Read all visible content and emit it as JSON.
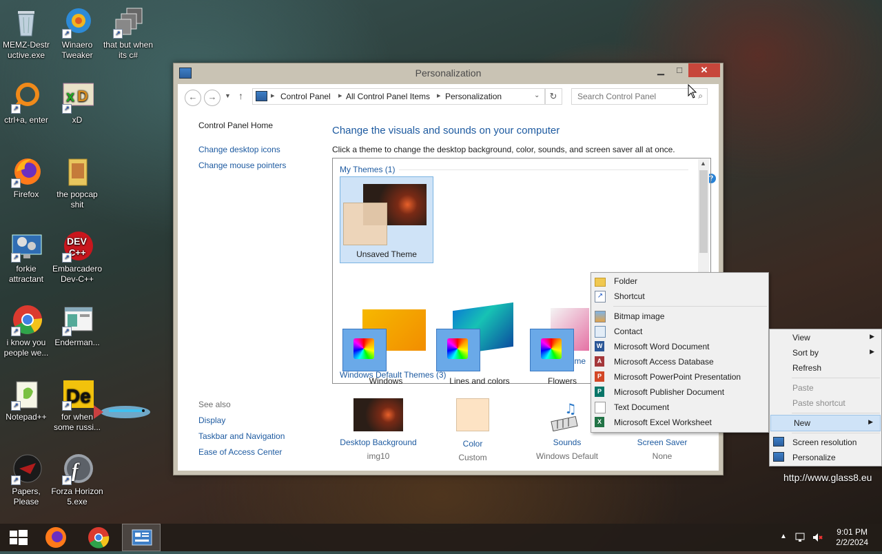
{
  "desktop": {
    "icons": [
      {
        "label": "MEMZ-Destr uctive.exe",
        "icon": "recycle-bin-icon"
      },
      {
        "label": "Winaero Tweaker",
        "icon": "winaero-icon"
      },
      {
        "label": "that but when its c#",
        "icon": "stack-icon"
      },
      {
        "label": "ctrl+a, enter",
        "icon": "ring-icon"
      },
      {
        "label": "xD",
        "icon": "xd-icon"
      },
      {
        "label": "Firefox",
        "icon": "firefox-icon"
      },
      {
        "label": "the popcap shit",
        "icon": "folder-icon"
      },
      {
        "label": "forkie attractant",
        "icon": "settings-monitor-icon"
      },
      {
        "label": "Embarcadero Dev-C++",
        "icon": "devcpp-icon"
      },
      {
        "label": "i know you people we...",
        "icon": "chrome-icon"
      },
      {
        "label": "Enderman...",
        "icon": "window-icon"
      },
      {
        "label": "Notepad++",
        "icon": "notepad-icon"
      },
      {
        "label": "for when some russi...",
        "icon": "de-icon"
      },
      {
        "label": "Papers, Please",
        "icon": "papers-please-icon"
      },
      {
        "label": "Forza Horizon 5.exe",
        "icon": "flash-icon"
      }
    ],
    "watermark": "http://www.glass8.eu"
  },
  "window": {
    "title": "Personalization",
    "breadcrumb": [
      "Control Panel",
      "All Control Panel Items",
      "Personalization"
    ],
    "search_placeholder": "Search Control Panel",
    "left_links": [
      "Control Panel Home",
      "Change desktop icons",
      "Change mouse pointers"
    ],
    "see_also_title": "See also",
    "see_also": [
      "Display",
      "Taskbar and Navigation",
      "Ease of Access Center"
    ],
    "heading": "Change the visuals and sounds on your computer",
    "subheading": "Click a theme to change the desktop background, color, sounds, and screen saver all at once.",
    "my_themes_header": "My Themes (1)",
    "my_theme_name": "Unsaved Theme",
    "save_theme": "Save theme",
    "default_themes_header": "Windows Default Themes (3)",
    "default_themes": [
      "Windows",
      "Lines and colors",
      "Flowers"
    ],
    "bottom": [
      {
        "label": "Desktop Background",
        "value": "img10"
      },
      {
        "label": "Color",
        "value": "Custom"
      },
      {
        "label": "Sounds",
        "value": "Windows Default"
      },
      {
        "label": "Screen Saver",
        "value": "None"
      }
    ]
  },
  "new_submenu": {
    "items": [
      "Folder",
      "Shortcut",
      "Bitmap image",
      "Contact",
      "Microsoft Word Document",
      "Microsoft Access Database",
      "Microsoft PowerPoint Presentation",
      "Microsoft Publisher Document",
      "Text Document",
      "Microsoft Excel Worksheet"
    ]
  },
  "context_menu": {
    "view": "View",
    "sort_by": "Sort by",
    "refresh": "Refresh",
    "paste": "Paste",
    "paste_shortcut": "Paste shortcut",
    "new": "New",
    "screen_resolution": "Screen resolution",
    "personalize": "Personalize"
  },
  "taskbar": {
    "time": "9:01 PM",
    "date": "2/2/2024"
  },
  "colors": {
    "link": "#1d5aa0",
    "highlight": "#cfe3f7",
    "close": "#c7463b"
  }
}
